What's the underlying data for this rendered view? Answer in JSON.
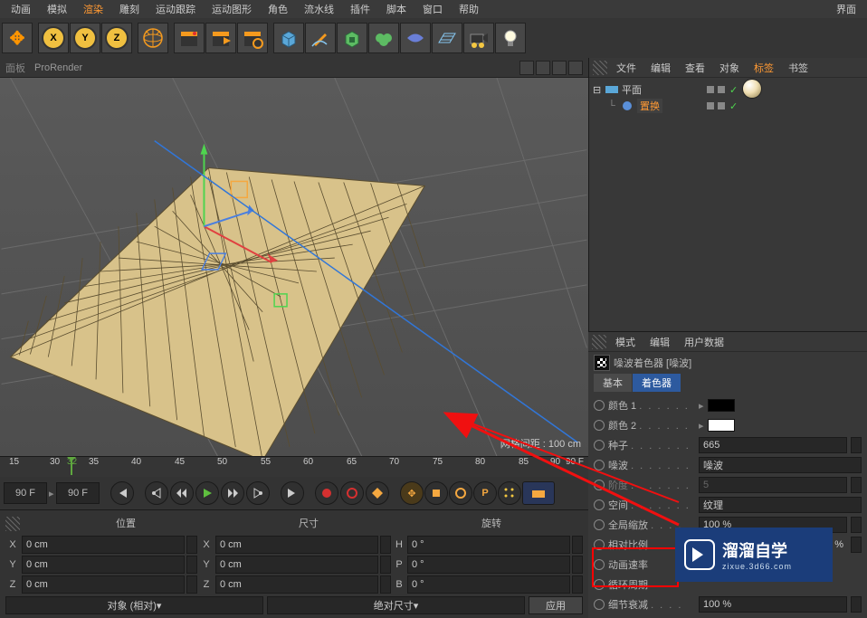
{
  "menu": {
    "items": [
      "动画",
      "模拟",
      "渲染",
      "雕刻",
      "运动跟踪",
      "运动图形",
      "角色",
      "流水线",
      "插件",
      "脚本",
      "窗口",
      "帮助"
    ],
    "active_index": 2,
    "right": "界面"
  },
  "viewport": {
    "panel_label": "面板",
    "renderer": "ProRender",
    "grid_info": "网格间距 : 100 cm"
  },
  "timeline": {
    "ticks": [
      "15",
      "30",
      "32",
      "35",
      "40",
      "45",
      "50",
      "55",
      "60",
      "65",
      "70",
      "75",
      "80",
      "85",
      "90",
      "90 F"
    ],
    "marker_label": "32",
    "frame_start": "90 F",
    "frame_end": "90 F"
  },
  "coords": {
    "headers": [
      "位置",
      "尺寸",
      "旋转"
    ],
    "rows": [
      {
        "axis": "X",
        "pos": "0 cm",
        "size": "0 cm",
        "rlabel": "H",
        "rot": "0 °"
      },
      {
        "axis": "Y",
        "pos": "0 cm",
        "size": "0 cm",
        "rlabel": "P",
        "rot": "0 °"
      },
      {
        "axis": "Z",
        "pos": "0 cm",
        "size": "0 cm",
        "rlabel": "B",
        "rot": "0 °"
      }
    ],
    "mode1": "对象 (相对)",
    "mode2": "绝对尺寸",
    "apply": "应用"
  },
  "obj_mgr": {
    "menu": [
      "文件",
      "编辑",
      "查看",
      "对象",
      "标签",
      "书签"
    ],
    "active_index": 4,
    "row0": "平面",
    "row1": "置换"
  },
  "attr_mgr": {
    "menu": [
      "模式",
      "编辑",
      "用户数据"
    ],
    "title": "噪波着色器 [噪波]",
    "tabs": [
      "基本",
      "着色器"
    ],
    "active_tab": 1,
    "rows": {
      "color1": {
        "label": "颜色 1"
      },
      "color2": {
        "label": "颜色 2"
      },
      "seed": {
        "label": "种子",
        "value": "665"
      },
      "noise": {
        "label": "噪波",
        "value": "噪波"
      },
      "octave": {
        "label": "阶度",
        "value": "5"
      },
      "space": {
        "label": "空间",
        "value": "纹理"
      },
      "gscale": {
        "label": "全局缩放",
        "value": "100 %"
      },
      "relscale": {
        "label": "相对比例",
        "value": "100 %"
      },
      "animspeed": {
        "label": "动画速率"
      },
      "cycle": {
        "label": "循环周期"
      },
      "detail": {
        "label": "细节衰减",
        "value": "100 %"
      }
    }
  },
  "watermark": {
    "cn": "溜溜自学",
    "en": "zixue.3d66.com"
  }
}
